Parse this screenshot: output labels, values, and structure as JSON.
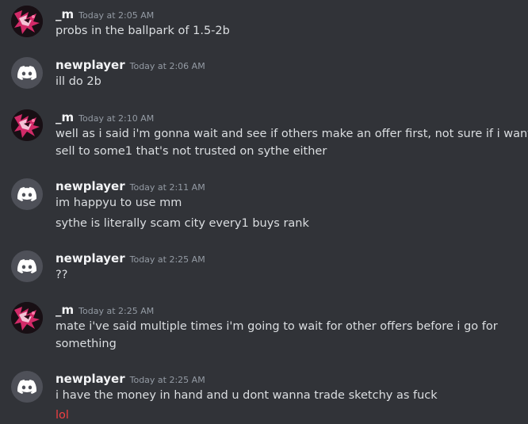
{
  "messages": [
    {
      "author": "_m",
      "timestamp": "Today at 2:05 AM",
      "avatar_icon": "anime-avatar-icon",
      "lines": [
        "probs in the ballpark of 1.5-2b"
      ]
    },
    {
      "author": "newplayer",
      "timestamp": "Today at 2:06 AM",
      "avatar_icon": "discord-default-avatar-icon",
      "lines": [
        "ill do 2b"
      ]
    },
    {
      "author": "_m",
      "timestamp": "Today at 2:10 AM",
      "avatar_icon": "anime-avatar-icon",
      "lines": [
        "well as i said i'm gonna wait and see if others make an offer first, not sure if i want to",
        "sell to some1 that's not trusted on sythe either"
      ]
    },
    {
      "author": "newplayer",
      "timestamp": "Today at 2:11 AM",
      "avatar_icon": "discord-default-avatar-icon",
      "lines": [
        "im happyu to use mm",
        "sythe is literally scam city every1 buys rank"
      ]
    },
    {
      "author": "newplayer",
      "timestamp": "Today at 2:25 AM",
      "avatar_icon": "discord-default-avatar-icon",
      "lines": [
        "??"
      ]
    },
    {
      "author": "_m",
      "timestamp": "Today at 2:25 AM",
      "avatar_icon": "anime-avatar-icon",
      "lines": [
        "mate i've said multiple times i'm going to wait for other offers before i go for",
        "something"
      ]
    },
    {
      "author": "newplayer",
      "timestamp": "Today at 2:25 AM",
      "avatar_icon": "discord-default-avatar-icon",
      "lines": [
        "i have the money in hand and u dont wanna trade sketchy as fuck",
        "lol"
      ]
    }
  ],
  "colors": {
    "background": "#313338",
    "username": "#f2f3f5",
    "timestamp": "#949ba4",
    "message_text": "#dbdee1",
    "failed_message_text": "#f23f42",
    "default_avatar_bg": "#4e5058",
    "anime_avatar_accent": "#d22a68"
  }
}
